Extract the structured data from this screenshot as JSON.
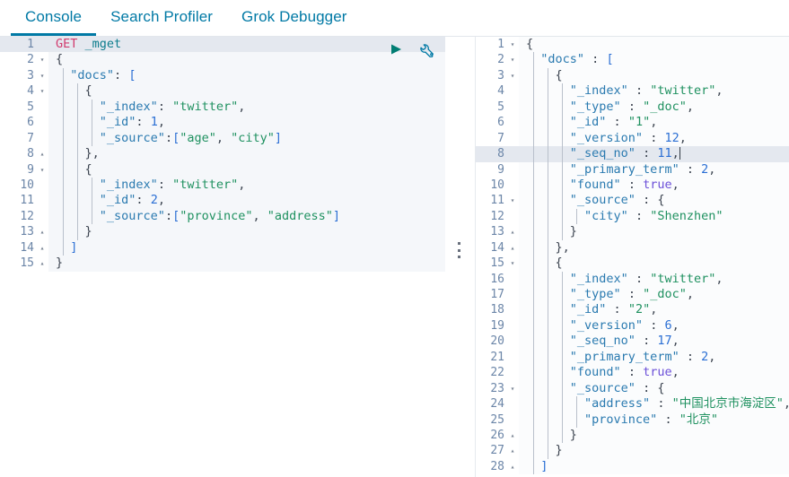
{
  "tabs": [
    {
      "label": "Console",
      "active": true
    },
    {
      "label": "Search Profiler",
      "active": false
    },
    {
      "label": "Grok Debugger",
      "active": false
    }
  ],
  "colors": {
    "accent": "#0079a5",
    "method": "#d13b6e",
    "url": "#0b7c8c",
    "key": "#2a7ab0",
    "string": "#1f9160",
    "number": "#2b6fd4",
    "boolean": "#6b4fd8",
    "play_icon": "#017d73",
    "wrench_icon": "#0079a5",
    "editor_bg": "#f5f7fa",
    "output_bg": "#fbfcfd",
    "active_line_bg": "#e4e8ef"
  },
  "toolbar": {
    "play_label": "play-request",
    "wrench_label": "request-options"
  },
  "request_editor": {
    "name": "console-request-editor",
    "active_line": 1,
    "lines": [
      {
        "n": 1,
        "fold": "",
        "indent": 0,
        "tokens": [
          {
            "t": "method",
            "v": "GET"
          },
          {
            "t": "punc",
            "v": " "
          },
          {
            "t": "url",
            "v": "_mget"
          }
        ]
      },
      {
        "n": 2,
        "fold": "v",
        "indent": 0,
        "tokens": [
          {
            "t": "punc",
            "v": "{"
          }
        ]
      },
      {
        "n": 3,
        "fold": "v",
        "indent": 1,
        "tokens": [
          {
            "t": "punc",
            "v": "  "
          },
          {
            "t": "key",
            "v": "\"docs\""
          },
          {
            "t": "punc",
            "v": ": "
          },
          {
            "t": "brk",
            "v": "["
          }
        ]
      },
      {
        "n": 4,
        "fold": "v",
        "indent": 2,
        "tokens": [
          {
            "t": "punc",
            "v": "    "
          },
          {
            "t": "punc",
            "v": "{"
          }
        ]
      },
      {
        "n": 5,
        "fold": "",
        "indent": 3,
        "tokens": [
          {
            "t": "punc",
            "v": "      "
          },
          {
            "t": "key",
            "v": "\"_index\""
          },
          {
            "t": "punc",
            "v": ": "
          },
          {
            "t": "str",
            "v": "\"twitter\""
          },
          {
            "t": "punc",
            "v": ","
          }
        ]
      },
      {
        "n": 6,
        "fold": "",
        "indent": 3,
        "tokens": [
          {
            "t": "punc",
            "v": "      "
          },
          {
            "t": "key",
            "v": "\"_id\""
          },
          {
            "t": "punc",
            "v": ": "
          },
          {
            "t": "num",
            "v": "1"
          },
          {
            "t": "punc",
            "v": ","
          }
        ]
      },
      {
        "n": 7,
        "fold": "",
        "indent": 3,
        "tokens": [
          {
            "t": "punc",
            "v": "      "
          },
          {
            "t": "key",
            "v": "\"_source\""
          },
          {
            "t": "punc",
            "v": ":"
          },
          {
            "t": "brk",
            "v": "["
          },
          {
            "t": "str",
            "v": "\"age\""
          },
          {
            "t": "punc",
            "v": ", "
          },
          {
            "t": "str",
            "v": "\"city\""
          },
          {
            "t": "brk",
            "v": "]"
          }
        ]
      },
      {
        "n": 8,
        "fold": "^",
        "indent": 2,
        "tokens": [
          {
            "t": "punc",
            "v": "    }, "
          }
        ]
      },
      {
        "n": 9,
        "fold": "v",
        "indent": 2,
        "tokens": [
          {
            "t": "punc",
            "v": "    {"
          }
        ]
      },
      {
        "n": 10,
        "fold": "",
        "indent": 3,
        "tokens": [
          {
            "t": "punc",
            "v": "      "
          },
          {
            "t": "key",
            "v": "\"_index\""
          },
          {
            "t": "punc",
            "v": ": "
          },
          {
            "t": "str",
            "v": "\"twitter\""
          },
          {
            "t": "punc",
            "v": ","
          }
        ]
      },
      {
        "n": 11,
        "fold": "",
        "indent": 3,
        "tokens": [
          {
            "t": "punc",
            "v": "      "
          },
          {
            "t": "key",
            "v": "\"_id\""
          },
          {
            "t": "punc",
            "v": ": "
          },
          {
            "t": "num",
            "v": "2"
          },
          {
            "t": "punc",
            "v": ","
          }
        ]
      },
      {
        "n": 12,
        "fold": "",
        "indent": 3,
        "tokens": [
          {
            "t": "punc",
            "v": "      "
          },
          {
            "t": "key",
            "v": "\"_source\""
          },
          {
            "t": "punc",
            "v": ":"
          },
          {
            "t": "brk",
            "v": "["
          },
          {
            "t": "str",
            "v": "\"province\""
          },
          {
            "t": "punc",
            "v": ", "
          },
          {
            "t": "str",
            "v": "\"address\""
          },
          {
            "t": "brk",
            "v": "]"
          }
        ]
      },
      {
        "n": 13,
        "fold": "^",
        "indent": 2,
        "tokens": [
          {
            "t": "punc",
            "v": "    }"
          }
        ]
      },
      {
        "n": 14,
        "fold": "^",
        "indent": 1,
        "tokens": [
          {
            "t": "brk",
            "v": "  ]"
          }
        ]
      },
      {
        "n": 15,
        "fold": "^",
        "indent": 0,
        "tokens": [
          {
            "t": "punc",
            "v": "}"
          }
        ]
      }
    ]
  },
  "response_editor": {
    "name": "console-response-output",
    "active_line": 8,
    "lines": [
      {
        "n": 1,
        "fold": "v",
        "indent": 0,
        "tokens": [
          {
            "t": "punc",
            "v": "{"
          }
        ]
      },
      {
        "n": 2,
        "fold": "v",
        "indent": 1,
        "tokens": [
          {
            "t": "punc",
            "v": "  "
          },
          {
            "t": "key",
            "v": "\"docs\""
          },
          {
            "t": "punc",
            "v": " : "
          },
          {
            "t": "brk",
            "v": "["
          }
        ]
      },
      {
        "n": 3,
        "fold": "v",
        "indent": 2,
        "tokens": [
          {
            "t": "punc",
            "v": "    {"
          }
        ]
      },
      {
        "n": 4,
        "fold": "",
        "indent": 3,
        "tokens": [
          {
            "t": "punc",
            "v": "      "
          },
          {
            "t": "key",
            "v": "\"_index\""
          },
          {
            "t": "punc",
            "v": " : "
          },
          {
            "t": "str",
            "v": "\"twitter\""
          },
          {
            "t": "punc",
            "v": ","
          }
        ]
      },
      {
        "n": 5,
        "fold": "",
        "indent": 3,
        "tokens": [
          {
            "t": "punc",
            "v": "      "
          },
          {
            "t": "key",
            "v": "\"_type\""
          },
          {
            "t": "punc",
            "v": " : "
          },
          {
            "t": "str",
            "v": "\"_doc\""
          },
          {
            "t": "punc",
            "v": ","
          }
        ]
      },
      {
        "n": 6,
        "fold": "",
        "indent": 3,
        "tokens": [
          {
            "t": "punc",
            "v": "      "
          },
          {
            "t": "key",
            "v": "\"_id\""
          },
          {
            "t": "punc",
            "v": " : "
          },
          {
            "t": "str",
            "v": "\"1\""
          },
          {
            "t": "punc",
            "v": ","
          }
        ]
      },
      {
        "n": 7,
        "fold": "",
        "indent": 3,
        "tokens": [
          {
            "t": "punc",
            "v": "      "
          },
          {
            "t": "key",
            "v": "\"_version\""
          },
          {
            "t": "punc",
            "v": " : "
          },
          {
            "t": "num",
            "v": "12"
          },
          {
            "t": "punc",
            "v": ","
          }
        ]
      },
      {
        "n": 8,
        "fold": "",
        "indent": 3,
        "caret": true,
        "tokens": [
          {
            "t": "punc",
            "v": "      "
          },
          {
            "t": "key",
            "v": "\"_seq_no\""
          },
          {
            "t": "punc",
            "v": " : "
          },
          {
            "t": "num",
            "v": "11"
          },
          {
            "t": "punc",
            "v": ","
          }
        ]
      },
      {
        "n": 9,
        "fold": "",
        "indent": 3,
        "tokens": [
          {
            "t": "punc",
            "v": "      "
          },
          {
            "t": "key",
            "v": "\"_primary_term\""
          },
          {
            "t": "punc",
            "v": " : "
          },
          {
            "t": "num",
            "v": "2"
          },
          {
            "t": "punc",
            "v": ","
          }
        ]
      },
      {
        "n": 10,
        "fold": "",
        "indent": 3,
        "tokens": [
          {
            "t": "punc",
            "v": "      "
          },
          {
            "t": "key",
            "v": "\"found\""
          },
          {
            "t": "punc",
            "v": " : "
          },
          {
            "t": "bool",
            "v": "true"
          },
          {
            "t": "punc",
            "v": ","
          }
        ]
      },
      {
        "n": 11,
        "fold": "v",
        "indent": 3,
        "tokens": [
          {
            "t": "punc",
            "v": "      "
          },
          {
            "t": "key",
            "v": "\"_source\""
          },
          {
            "t": "punc",
            "v": " : "
          },
          {
            "t": "punc",
            "v": "{"
          }
        ]
      },
      {
        "n": 12,
        "fold": "",
        "indent": 4,
        "tokens": [
          {
            "t": "punc",
            "v": "        "
          },
          {
            "t": "key",
            "v": "\"city\""
          },
          {
            "t": "punc",
            "v": " : "
          },
          {
            "t": "str",
            "v": "\"Shenzhen\""
          }
        ]
      },
      {
        "n": 13,
        "fold": "^",
        "indent": 3,
        "tokens": [
          {
            "t": "punc",
            "v": "      }"
          }
        ]
      },
      {
        "n": 14,
        "fold": "^",
        "indent": 2,
        "tokens": [
          {
            "t": "punc",
            "v": "    },"
          }
        ]
      },
      {
        "n": 15,
        "fold": "v",
        "indent": 2,
        "tokens": [
          {
            "t": "punc",
            "v": "    {"
          }
        ]
      },
      {
        "n": 16,
        "fold": "",
        "indent": 3,
        "tokens": [
          {
            "t": "punc",
            "v": "      "
          },
          {
            "t": "key",
            "v": "\"_index\""
          },
          {
            "t": "punc",
            "v": " : "
          },
          {
            "t": "str",
            "v": "\"twitter\""
          },
          {
            "t": "punc",
            "v": ","
          }
        ]
      },
      {
        "n": 17,
        "fold": "",
        "indent": 3,
        "tokens": [
          {
            "t": "punc",
            "v": "      "
          },
          {
            "t": "key",
            "v": "\"_type\""
          },
          {
            "t": "punc",
            "v": " : "
          },
          {
            "t": "str",
            "v": "\"_doc\""
          },
          {
            "t": "punc",
            "v": ","
          }
        ]
      },
      {
        "n": 18,
        "fold": "",
        "indent": 3,
        "tokens": [
          {
            "t": "punc",
            "v": "      "
          },
          {
            "t": "key",
            "v": "\"_id\""
          },
          {
            "t": "punc",
            "v": " : "
          },
          {
            "t": "str",
            "v": "\"2\""
          },
          {
            "t": "punc",
            "v": ","
          }
        ]
      },
      {
        "n": 19,
        "fold": "",
        "indent": 3,
        "tokens": [
          {
            "t": "punc",
            "v": "      "
          },
          {
            "t": "key",
            "v": "\"_version\""
          },
          {
            "t": "punc",
            "v": " : "
          },
          {
            "t": "num",
            "v": "6"
          },
          {
            "t": "punc",
            "v": ","
          }
        ]
      },
      {
        "n": 20,
        "fold": "",
        "indent": 3,
        "tokens": [
          {
            "t": "punc",
            "v": "      "
          },
          {
            "t": "key",
            "v": "\"_seq_no\""
          },
          {
            "t": "punc",
            "v": " : "
          },
          {
            "t": "num",
            "v": "17"
          },
          {
            "t": "punc",
            "v": ","
          }
        ]
      },
      {
        "n": 21,
        "fold": "",
        "indent": 3,
        "tokens": [
          {
            "t": "punc",
            "v": "      "
          },
          {
            "t": "key",
            "v": "\"_primary_term\""
          },
          {
            "t": "punc",
            "v": " : "
          },
          {
            "t": "num",
            "v": "2"
          },
          {
            "t": "punc",
            "v": ","
          }
        ]
      },
      {
        "n": 22,
        "fold": "",
        "indent": 3,
        "tokens": [
          {
            "t": "punc",
            "v": "      "
          },
          {
            "t": "key",
            "v": "\"found\""
          },
          {
            "t": "punc",
            "v": " : "
          },
          {
            "t": "bool",
            "v": "true"
          },
          {
            "t": "punc",
            "v": ","
          }
        ]
      },
      {
        "n": 23,
        "fold": "v",
        "indent": 3,
        "tokens": [
          {
            "t": "punc",
            "v": "      "
          },
          {
            "t": "key",
            "v": "\"_source\""
          },
          {
            "t": "punc",
            "v": " : "
          },
          {
            "t": "punc",
            "v": "{"
          }
        ]
      },
      {
        "n": 24,
        "fold": "",
        "indent": 4,
        "tokens": [
          {
            "t": "punc",
            "v": "        "
          },
          {
            "t": "key",
            "v": "\"address\""
          },
          {
            "t": "punc",
            "v": " : "
          },
          {
            "t": "str",
            "v": "\"中国北京市海淀区\""
          },
          {
            "t": "punc",
            "v": ","
          }
        ]
      },
      {
        "n": 25,
        "fold": "",
        "indent": 4,
        "tokens": [
          {
            "t": "punc",
            "v": "        "
          },
          {
            "t": "key",
            "v": "\"province\""
          },
          {
            "t": "punc",
            "v": " : "
          },
          {
            "t": "str",
            "v": "\"北京\""
          }
        ]
      },
      {
        "n": 26,
        "fold": "^",
        "indent": 3,
        "tokens": [
          {
            "t": "punc",
            "v": "      }"
          }
        ]
      },
      {
        "n": 27,
        "fold": "^",
        "indent": 2,
        "tokens": [
          {
            "t": "punc",
            "v": "    }"
          }
        ]
      },
      {
        "n": 28,
        "fold": "^",
        "indent": 1,
        "tokens": [
          {
            "t": "brk",
            "v": "  ]"
          }
        ]
      }
    ]
  }
}
